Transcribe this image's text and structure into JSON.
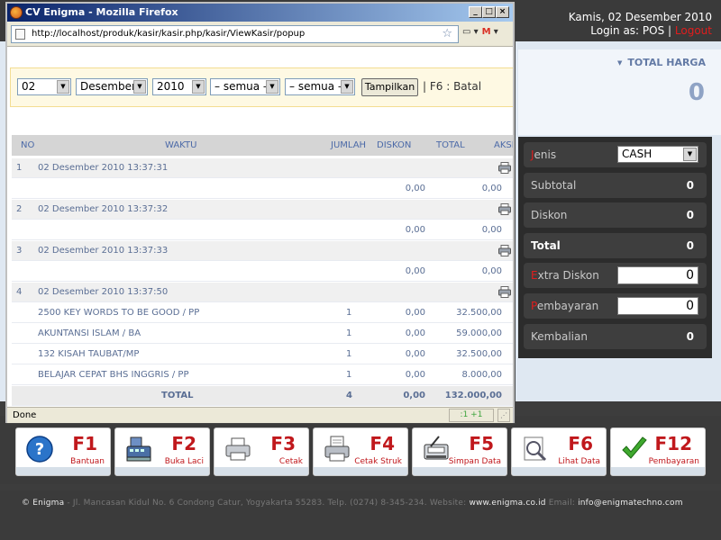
{
  "app": {
    "date": "Kamis, 02 Desember 2010",
    "login_prefix": "Login as: POS",
    "separator": "|",
    "logout": "Logout"
  },
  "total_panel": {
    "label": "TOTAL HARGA",
    "value": "0"
  },
  "summary": {
    "jenis_label_first": "J",
    "jenis_label_rest": "enis",
    "jenis_value": "CASH",
    "subtotal_label": "Subtotal",
    "subtotal_value": "0",
    "diskon_label": "Diskon",
    "diskon_value": "0",
    "total_label": "Total",
    "total_value": "0",
    "extra_label_first": "E",
    "extra_label_rest": "xtra Diskon",
    "extra_value": "0",
    "bayar_label_first": "P",
    "bayar_label_rest": "embayaran",
    "bayar_value": "0",
    "kembalian_label": "Kembalian",
    "kembalian_value": "0"
  },
  "fkeys": [
    {
      "code": "F1",
      "label": "Bantuan",
      "icon": "help-icon"
    },
    {
      "code": "F2",
      "label": "Buka Laci",
      "icon": "cash-register-icon"
    },
    {
      "code": "F3",
      "label": "Cetak",
      "icon": "printer-icon"
    },
    {
      "code": "F4",
      "label": "Cetak Struk",
      "icon": "receipt-printer-icon"
    },
    {
      "code": "F5",
      "label": "Simpan Data",
      "icon": "save-data-icon"
    },
    {
      "code": "F6",
      "label": "Lihat Data",
      "icon": "view-data-icon"
    },
    {
      "code": "F12",
      "label": "Pembayaran",
      "icon": "checkmark-icon"
    }
  ],
  "footer": {
    "brand": "© Enigma",
    "address": "- Jl. Mancasan Kidul No. 6 Condong Catur, Yogyakarta 55283. Telp. (0274) 8-345-234. Website:",
    "website": "www.enigma.co.id",
    "email_label": "Email:",
    "email": "info@enigmatechno.com"
  },
  "popup": {
    "title": "CV Enigma - Mozilla Firefox",
    "url": "http://localhost/produk/kasir/kasir.php/kasir/ViewKasir/popup",
    "status": "Done",
    "status_right": ":1 +1",
    "filters": {
      "day": "02",
      "month": "Desember",
      "year": "2010",
      "filter1": "– semua –",
      "filter2": "– semua –",
      "button": "Tampilkan",
      "hint": "| F6 : Batal"
    },
    "columns": {
      "no": "NO",
      "waktu": "WAKTU",
      "jumlah": "JUMLAH",
      "diskon": "DISKON",
      "total": "TOTAL",
      "aksi": "AKSI"
    },
    "transactions": [
      {
        "no": "1",
        "waktu": "02 Desember 2010 13:37:31",
        "diskon": "0,00",
        "total": "0,00",
        "items": []
      },
      {
        "no": "2",
        "waktu": "02 Desember 2010 13:37:32",
        "diskon": "0,00",
        "total": "0,00",
        "items": []
      },
      {
        "no": "3",
        "waktu": "02 Desember 2010 13:37:33",
        "diskon": "0,00",
        "total": "0,00",
        "items": []
      },
      {
        "no": "4",
        "waktu": "02 Desember 2010 13:37:50",
        "items": [
          {
            "name": "2500 KEY WORDS TO BE GOOD / PP",
            "jumlah": "1",
            "diskon": "0,00",
            "total": "32.500,00"
          },
          {
            "name": "AKUNTANSI ISLAM / BA",
            "jumlah": "1",
            "diskon": "0,00",
            "total": "59.000,00"
          },
          {
            "name": "132 KISAH TAUBAT/MP",
            "jumlah": "1",
            "diskon": "0,00",
            "total": "32.500,00"
          },
          {
            "name": "BELAJAR CEPAT BHS INGGRIS / PP",
            "jumlah": "1",
            "diskon": "0,00",
            "total": "8.000,00"
          }
        ]
      }
    ],
    "totals": {
      "label": "TOTAL",
      "jumlah": "4",
      "diskon": "0,00",
      "total": "132.000,00"
    }
  }
}
